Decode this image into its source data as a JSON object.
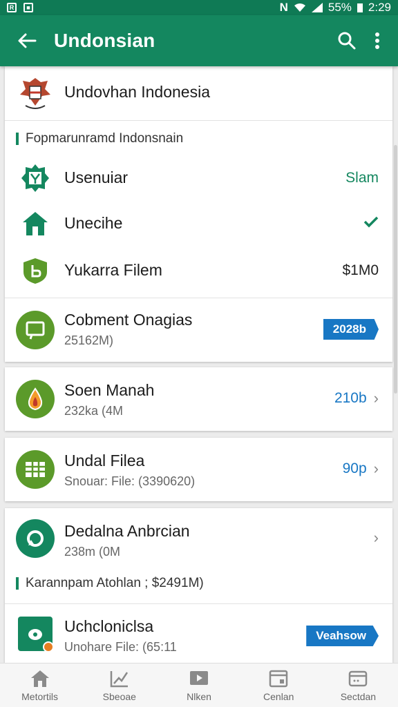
{
  "status_bar": {
    "battery": "55%",
    "time": "2:29"
  },
  "app_bar": {
    "title": "Undonsian"
  },
  "header_card": {
    "title": "Undovhan Indonesia"
  },
  "section1": {
    "label": "Fopmarunramd Indonsnain",
    "items": [
      {
        "label": "Usenuiar",
        "value": "Slam",
        "icon": "gear-map-icon"
      },
      {
        "label": "Unecihe",
        "value": "",
        "icon": "house-icon",
        "check": true
      },
      {
        "label": "Yukarra Filem",
        "value": "$1M0",
        "icon": "shield-icon"
      }
    ]
  },
  "card_cobment": {
    "title": "Cobment Onagias",
    "subtitle": "25162M)",
    "badge": "2028b"
  },
  "card_soen": {
    "title": "Soen Manah",
    "subtitle": "232ka (4M",
    "value": "210b"
  },
  "card_undal": {
    "title": "Undal Filea",
    "subtitle": "Snouar: File: (3390620)",
    "value": "90p"
  },
  "card_dedalna": {
    "title": "Dedalna Anbrcian",
    "subtitle": "238m (0M"
  },
  "section2": {
    "label": "Karannpam Atohlan ; $2491M)"
  },
  "card_uchclo": {
    "title": "Uchcloniclsa",
    "subtitle": "Unohare File: (65:11",
    "badge": "Veahsow"
  },
  "colors": {
    "primary": "#14875f",
    "accent_blue": "#1877c4",
    "olive": "#5b9a2a"
  },
  "bottom_nav": [
    {
      "label": "Metortils",
      "icon": "home-icon"
    },
    {
      "label": "Sbeoae",
      "icon": "chart-icon"
    },
    {
      "label": "Nlken",
      "icon": "play-icon"
    },
    {
      "label": "Cenlan",
      "icon": "card-icon"
    },
    {
      "label": "Sectdan",
      "icon": "wallet-icon"
    }
  ]
}
